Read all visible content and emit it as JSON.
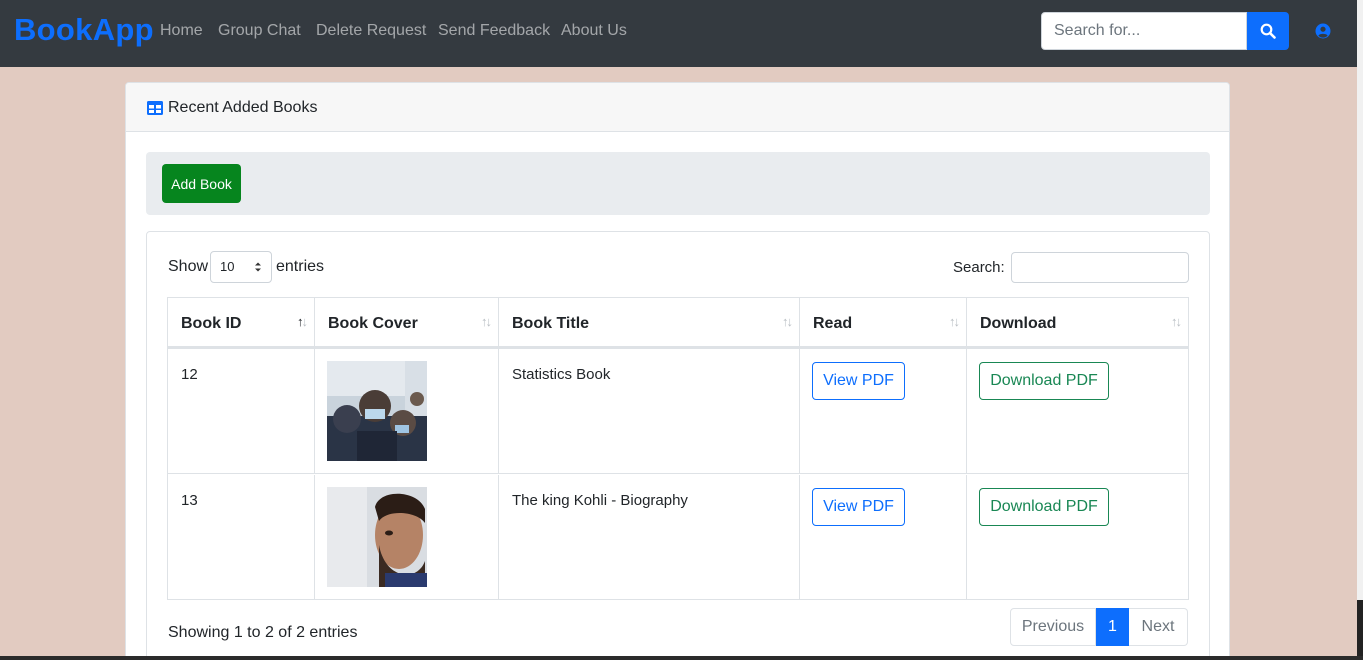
{
  "navbar": {
    "brand": "BookApp",
    "links": [
      "Home",
      "Group Chat",
      "Delete Request",
      "Send Feedback",
      "About Us"
    ],
    "search_placeholder": "Search for...",
    "colors": {
      "background": "#343a40",
      "brand": "#0d6efd",
      "primary": "#0d6efd"
    }
  },
  "card": {
    "title": "Recent Added Books",
    "add_book_label": "Add Book"
  },
  "datatable": {
    "show_label": "Show",
    "page_length": "10",
    "entries_label": "entries",
    "search_label": "Search:",
    "columns": [
      "Book ID",
      "Book Cover",
      "Book Title",
      "Read",
      "Download"
    ],
    "rows": [
      {
        "id": "12",
        "title": "Statistics Book",
        "read": "View PDF",
        "download": "Download PDF",
        "cover_icon": "group-photo-cover"
      },
      {
        "id": "13",
        "title": "The king Kohli - Biography",
        "read": "View PDF",
        "download": "Download PDF",
        "cover_icon": "portrait-photo-cover"
      }
    ],
    "info": "Showing 1 to 2 of 2 entries",
    "pagination": {
      "previous": "Previous",
      "current": "1",
      "next": "Next"
    }
  },
  "page_background": "#e2cbc1"
}
